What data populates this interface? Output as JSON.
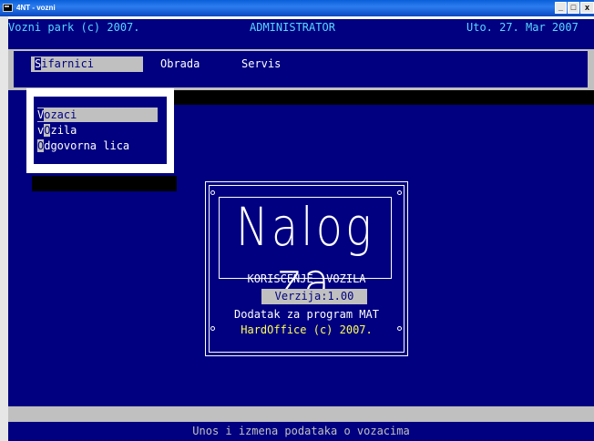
{
  "window": {
    "title": "4NT - vozni",
    "minimize": "_",
    "maximize": "□",
    "close": "x"
  },
  "header": {
    "left": "Vozni park (c) 2007.",
    "center": "ADMINISTRATOR",
    "right": "Uto. 27. Mar 2007"
  },
  "menu": {
    "items": [
      {
        "hotkey": "S",
        "rest": "ifarnici",
        "active": true
      },
      {
        "hotkey": "O",
        "rest": "brada",
        "active": false
      },
      {
        "hotkey": "S",
        "rest": "ervis",
        "active": false
      }
    ]
  },
  "dropdown": {
    "items": [
      {
        "pre": "",
        "hotkey": "V",
        "rest": "ozaci",
        "selected": true
      },
      {
        "pre": "v",
        "hotkey": "O",
        "rest": "zila",
        "selected": false
      },
      {
        "pre": "",
        "hotkey": "O",
        "rest": "dgovorna lica",
        "selected": false
      }
    ]
  },
  "splash": {
    "logo_text": "Nalog za",
    "subtitle": "KORISCENJE  VOZILA",
    "version": "Verzija:1.00",
    "addon": "Dodatak za program MAT",
    "copyright": "HardOffice (c) 2007."
  },
  "status": {
    "text": "Unos i izmena podataka o vozacima"
  },
  "colors": {
    "background": "#000080",
    "highlight": "#c0c0c0",
    "text": "#ffffff",
    "accent": "#ffff55",
    "header": "#5ad7ff"
  }
}
